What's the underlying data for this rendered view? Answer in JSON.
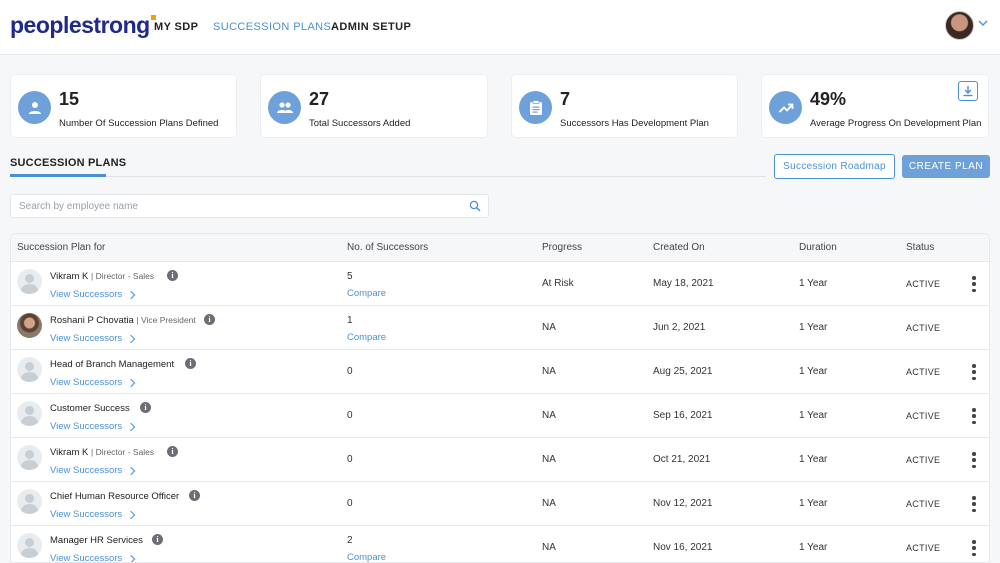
{
  "header": {
    "logo_text": "peoplestrong",
    "nav": [
      "MY SDP",
      "SUCCESSION PLANS",
      "ADMIN SETUP"
    ],
    "active_nav": "SUCCESSION PLANS"
  },
  "stats": [
    {
      "value": "15",
      "label": "Number Of Succession Plans Defined",
      "icon": "person-icon"
    },
    {
      "value": "27",
      "label": "Total Successors Added",
      "icon": "people-icon"
    },
    {
      "value": "7",
      "label": "Successors Has Development Plan",
      "icon": "clipboard-icon"
    },
    {
      "value": "49%",
      "label": "Average Progress On Development Plan",
      "icon": "trending-up-icon"
    }
  ],
  "tab_label": "SUCCESSION PLANS",
  "buttons": {
    "roadmap": "Succession Roadmap",
    "create": "CREATE PLAN"
  },
  "search": {
    "placeholder": "Search by employee name"
  },
  "table": {
    "headers": [
      "Succession Plan for",
      "No. of Successors",
      "Progress",
      "Created On",
      "Duration",
      "Status"
    ],
    "rows": [
      {
        "name": "Vikram K",
        "sub": "| Director - Sales",
        "view": "View Successors",
        "successors": "5",
        "compare": "Compare",
        "progress": "At Risk",
        "created": "May 18, 2021",
        "duration": "1 Year",
        "status": "ACTIVE"
      },
      {
        "name": "Roshani P Chovatia",
        "sub": "| Vice President",
        "view": "View Successors",
        "successors": "1",
        "compare": "Compare",
        "progress": "NA",
        "created": "Jun 2, 2021",
        "duration": "1 Year",
        "status": "ACTIVE"
      },
      {
        "name": "Head of Branch Management",
        "sub": "",
        "view": "View Successors",
        "successors": "0",
        "compare": "",
        "progress": "NA",
        "created": "Aug 25, 2021",
        "duration": "1 Year",
        "status": "ACTIVE"
      },
      {
        "name": "Customer Success",
        "sub": "",
        "view": "View Successors",
        "successors": "0",
        "compare": "",
        "progress": "NA",
        "created": "Sep 16, 2021",
        "duration": "1 Year",
        "status": "ACTIVE"
      },
      {
        "name": "Vikram K",
        "sub": "| Director - Sales",
        "view": "View Successors",
        "successors": "0",
        "compare": "",
        "progress": "NA",
        "created": "Oct 21, 2021",
        "duration": "1 Year",
        "status": "ACTIVE"
      },
      {
        "name": "Chief Human Resource Officer",
        "sub": "",
        "view": "View Successors",
        "successors": "0",
        "compare": "",
        "progress": "NA",
        "created": "Nov 12, 2021",
        "duration": "1 Year",
        "status": "ACTIVE"
      },
      {
        "name": "Manager HR Services",
        "sub": "",
        "view": "View Successors",
        "successors": "2",
        "compare": "Compare",
        "progress": "NA",
        "created": "Nov 16, 2021",
        "duration": "1 Year",
        "status": "ACTIVE"
      }
    ]
  },
  "colors": {
    "accent": "#4a90d9",
    "brand": "#1f2a8a",
    "icon_circle": "#6ea0d9"
  }
}
